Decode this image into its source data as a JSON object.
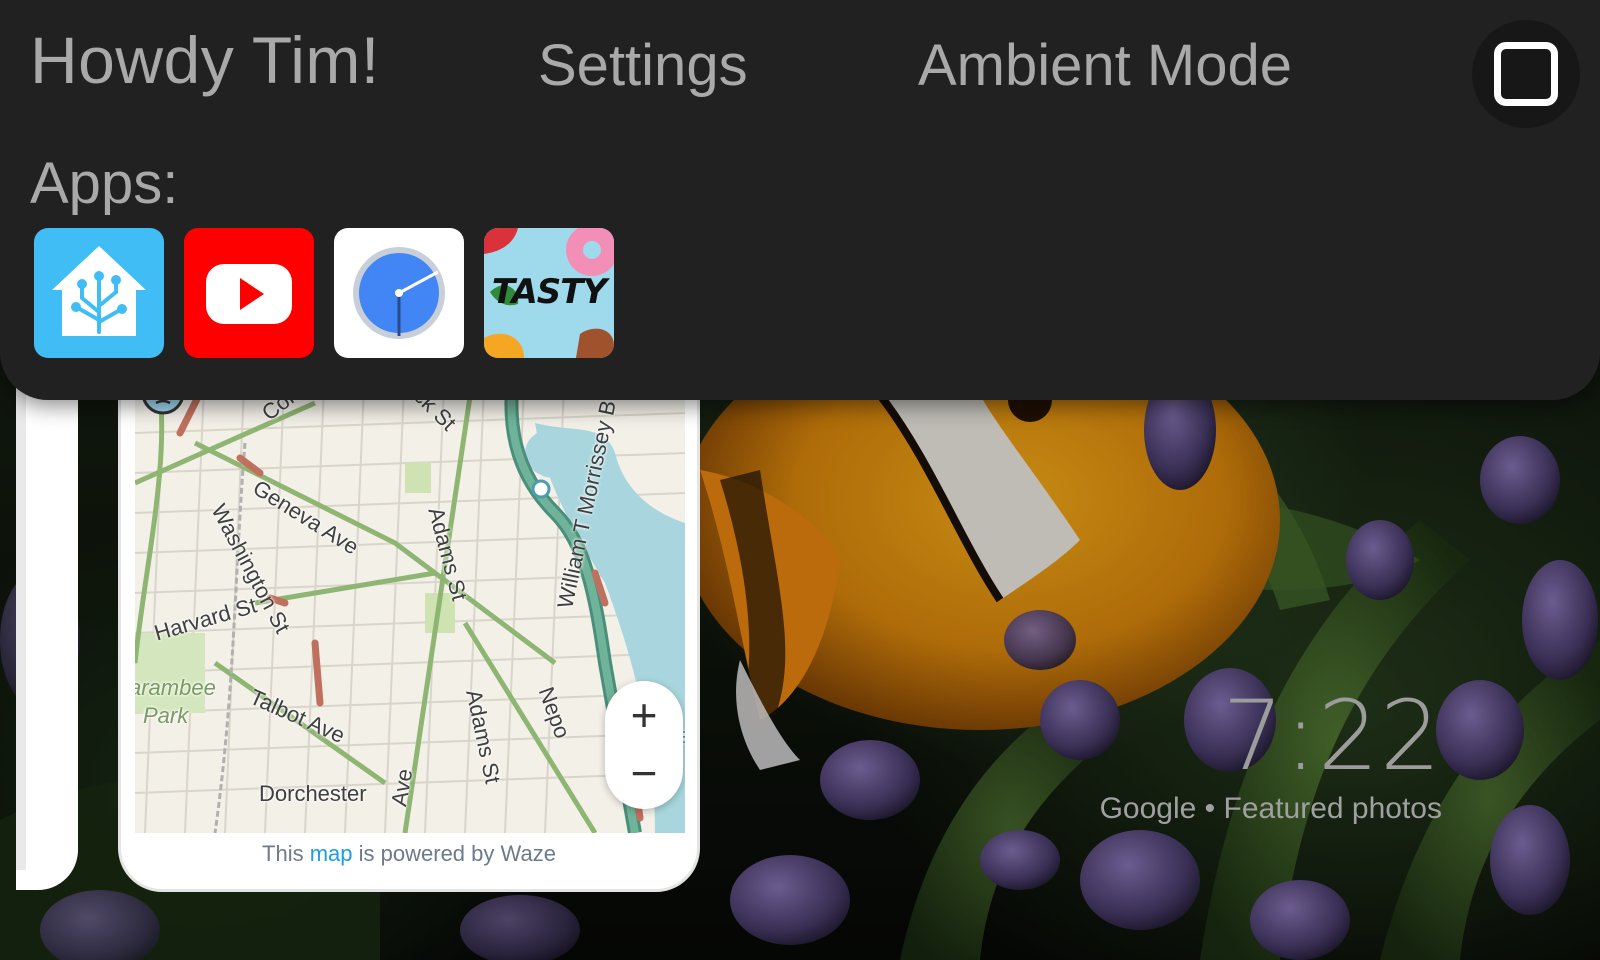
{
  "header": {
    "greeting": "Howdy Tim!",
    "settings_label": "Settings",
    "ambient_label": "Ambient Mode",
    "stop_icon": "stop-icon"
  },
  "apps": {
    "label": "Apps:",
    "items": [
      {
        "name": "Home Assistant",
        "icon": "home-assistant-icon",
        "color": "#41bdf5"
      },
      {
        "name": "YouTube",
        "icon": "youtube-icon",
        "color": "#ff0000"
      },
      {
        "name": "Clock",
        "icon": "clock-icon",
        "color": "#ffffff"
      },
      {
        "name": "Tasty",
        "icon": "tasty-icon",
        "label": "TASTY",
        "color": "#9fd9ec"
      }
    ]
  },
  "map": {
    "streets": [
      "Columbia",
      "cock St",
      "Geneva Ave",
      "Washington St",
      "Adams St",
      "William T Morrissey B",
      "Harvard St",
      "arambee",
      "Park",
      "Talbot Ave",
      "Adams St",
      "Nepo",
      "Dorchester",
      "Ave",
      "ase"
    ],
    "zoom_in": "+",
    "zoom_out": "−",
    "footer_prefix": "This",
    "footer_link": "map",
    "footer_suffix": "is powered by Waze"
  },
  "ambient": {
    "time": "7:22",
    "credit": "Google • Featured photos"
  }
}
